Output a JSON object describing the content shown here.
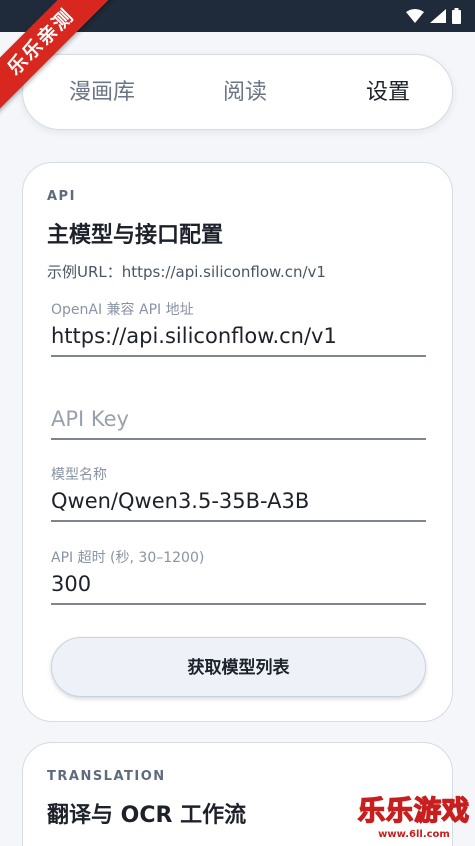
{
  "ribbon": {
    "text": "乐乐亲测"
  },
  "nav": {
    "tabs": [
      {
        "label": "漫画库"
      },
      {
        "label": "阅读"
      },
      {
        "label": "设置"
      }
    ],
    "active_tab": "设置"
  },
  "api_card": {
    "tag": "API",
    "title": "主模型与接口配置",
    "hint": "示例URL：https://api.siliconflow.cn/v1",
    "fields": {
      "base_url": {
        "label": "OpenAI 兼容 API 地址",
        "value": "https://api.siliconflow.cn/v1"
      },
      "api_key": {
        "placeholder": "API Key",
        "value": ""
      },
      "model_name": {
        "label": "模型名称",
        "value": "Qwen/Qwen3.5-35B-A3B"
      },
      "timeout": {
        "label": "API 超时 (秒, 30–1200)",
        "value": "300"
      }
    },
    "fetch_button": "获取模型列表"
  },
  "translation_card": {
    "tag": "TRANSLATION",
    "title": "翻译与 OCR 工作流"
  },
  "watermark": {
    "main": "乐乐游戏",
    "url": "www.6ll.com"
  },
  "colors": {
    "status_bar": "#1f2a3a",
    "background": "#f4f6f9",
    "ribbon": "#d7271f",
    "text_primary": "#1d2129",
    "text_muted": "#6b7585"
  }
}
